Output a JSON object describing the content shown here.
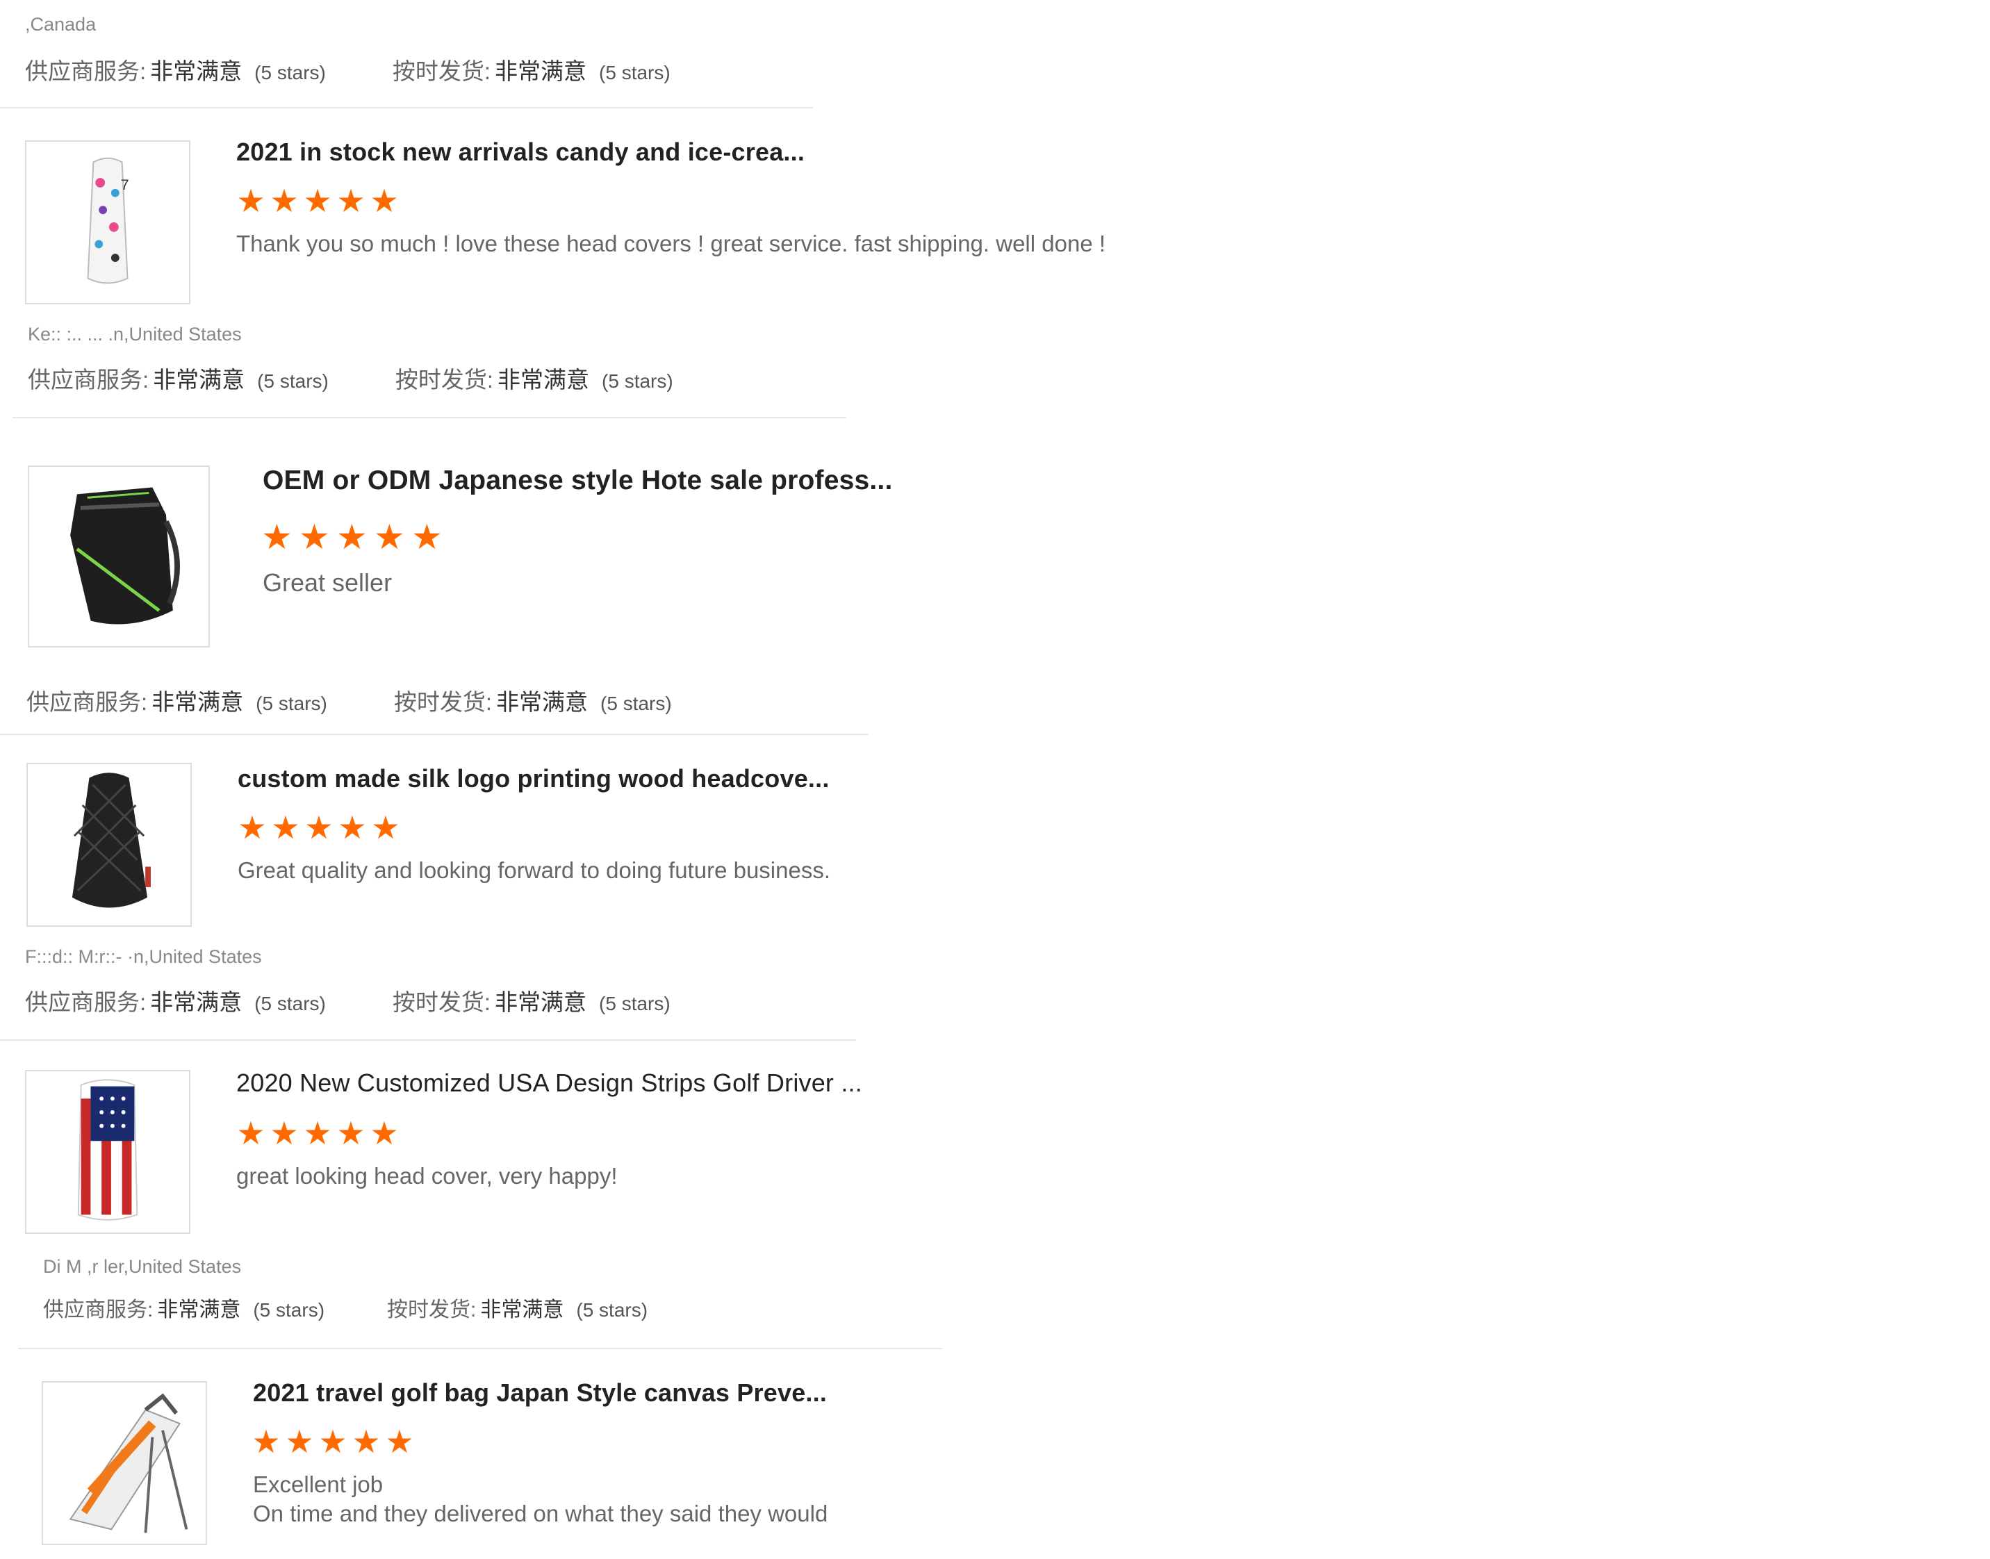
{
  "top": {
    "buyer_location": ",Canada",
    "supplier_label": "供应商服务:",
    "supplier_value": "非常满意",
    "supplier_stars": "(5 stars)",
    "shipping_label": "按时发货:",
    "shipping_value": "非常满意",
    "shipping_stars": "(5 stars)"
  },
  "reviews": [
    {
      "title": "2021 in stock new arrivals candy and ice-crea...",
      "rating": 5,
      "comment": "Thank you so much ! love these head covers ! great service.  fast shipping. well done !",
      "buyer": "Ke:: :.. ... .n,United States",
      "supplier_label": "供应商服务:",
      "supplier_value": "非常满意",
      "supplier_stars": "(5 stars)",
      "shipping_label": "按时发货:",
      "shipping_value": "非常满意",
      "shipping_stars": "(5 stars)",
      "image_icon": "candy-headcover-icon"
    },
    {
      "title": "OEM or ODM Japanese style Hote sale profess...",
      "rating": 5,
      "comment": "Great seller",
      "supplier_label": "供应商服务:",
      "supplier_value": "非常满意",
      "supplier_stars": "(5 stars)",
      "shipping_label": "按时发货:",
      "shipping_value": "非常满意",
      "shipping_stars": "(5 stars)",
      "image_icon": "black-golf-bag-icon"
    },
    {
      "title": "custom made silk logo printing wood headcove...",
      "rating": 5,
      "comment": "Great quality and looking forward to doing future business.",
      "buyer": "F:::d:: M:r::- ·n,United States",
      "supplier_label": "供应商服务:",
      "supplier_value": "非常满意",
      "supplier_stars": "(5 stars)",
      "shipping_label": "按时发货:",
      "shipping_value": "非常满意",
      "shipping_stars": "(5 stars)",
      "image_icon": "quilted-headcover-icon"
    },
    {
      "title": "2020 New Customized USA Design Strips Golf Driver ...",
      "rating": 5,
      "comment": "great looking head cover, very happy!",
      "buyer": "Di    M  ,r  ler,United States",
      "supplier_label": "供应商服务:",
      "supplier_value": "非常满意",
      "supplier_stars": "(5 stars)",
      "shipping_label": "按时发货:",
      "shipping_value": "非常满意",
      "shipping_stars": "(5 stars)",
      "image_icon": "usa-flag-headcover-icon"
    },
    {
      "title": "2021 travel golf bag Japan Style canvas Preve...",
      "rating": 5,
      "comment": "Excellent job",
      "comment_line2": "On time and they delivered on what they said they would",
      "image_icon": "stand-golf-bag-icon"
    }
  ],
  "colors": {
    "star": "#ff6a00",
    "divider": "#e6e6e6",
    "text": "#333333",
    "muted": "#666666"
  }
}
